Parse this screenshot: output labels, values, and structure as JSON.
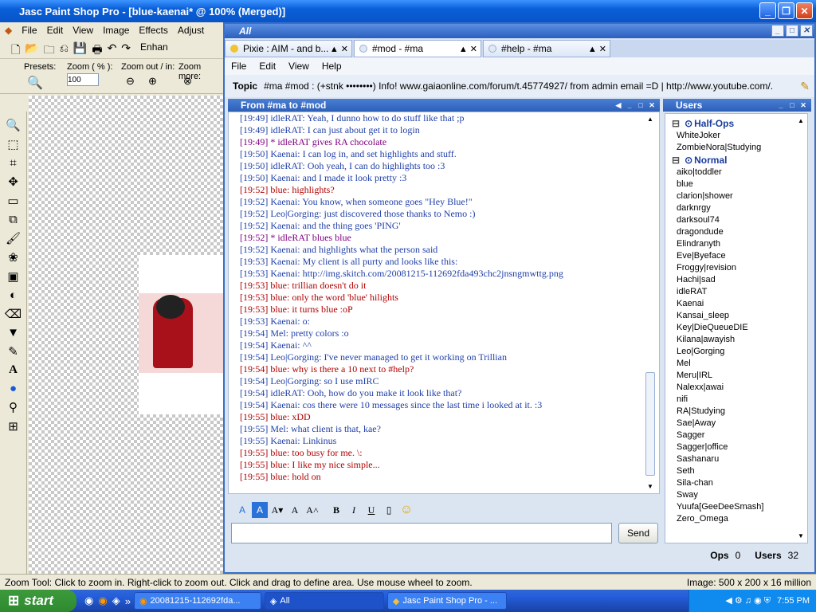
{
  "psp": {
    "title": "Jasc Paint Shop Pro - [blue-kaenai* @ 100% (Merged)]",
    "menu": [
      "File",
      "Edit",
      "View",
      "Image",
      "Effects",
      "Adjust"
    ],
    "opts": {
      "presets": "Presets:",
      "zoom_pct": "Zoom ( % ):",
      "zoom_value": "100",
      "zoom_outin": "Zoom out / in:",
      "zoom_more": "Zoom more:",
      "enhance": "Enhan"
    },
    "status_left": "Zoom Tool: Click to zoom in. Right-click to zoom out. Click and drag to define area. Use mouse wheel to zoom.",
    "status_right": "Image:  500 x 200 x 16 million"
  },
  "taskbar": {
    "start": "start",
    "tasks": [
      "20081215-112692fda...",
      "All",
      "Jasc Paint Shop Pro - ..."
    ],
    "clock": "7:55 PM"
  },
  "trillian": {
    "title": "All",
    "tabs": [
      {
        "label": "Pixie : AIM - and b...",
        "dot": "#f1c232"
      },
      {
        "label": "#mod - #ma",
        "dot": "#e0e8f4"
      },
      {
        "label": "#help - #ma",
        "dot": "#e0e8f4"
      }
    ],
    "menu": [
      "File",
      "Edit",
      "View",
      "Help"
    ],
    "topic_label": "Topic",
    "topic_text": "#ma #mod : (+stnk ••••••••) Info! www.gaiaonline.com/forum/t.45774927/ from admin email =D | http://www.youtube.com/...",
    "chat_title": "From #ma to #mod",
    "lines": [
      {
        "t": "[19:49] idleRAT: Yeah, I dunno how to do stuff like that ;p",
        "c": "#1f3fa8",
        "nick": "idleRAT"
      },
      {
        "t": "[19:49] idleRAT: I can just about get it to login",
        "c": "#1f3fa8"
      },
      {
        "t": "[19:49] * idleRAT gives RA chocolate",
        "c": "#800080"
      },
      {
        "t": "[19:50] Kaenai: I can log in, and set highlights and stuff.",
        "c": "#1f3fa8"
      },
      {
        "t": "[19:50] idleRAT: Ooh yeah, I can do highlights too :3",
        "c": "#1f3fa8"
      },
      {
        "t": "[19:50] Kaenai: and I made it look pretty :3",
        "c": "#1f3fa8"
      },
      {
        "t": "[19:52] blue: highlights?",
        "c": "#b00000"
      },
      {
        "t": "[19:52] Kaenai: You know, when someone goes \"Hey Blue!\"",
        "c": "#1f3fa8"
      },
      {
        "t": "[19:52] Leo|Gorging: just discovered those thanks to Nemo :)",
        "c": "#1f3fa8"
      },
      {
        "t": "[19:52] Kaenai: and the thing goes 'PING'",
        "c": "#1f3fa8"
      },
      {
        "t": "[19:52] * idleRAT blues blue",
        "c": "#800080"
      },
      {
        "t": "[19:52] Kaenai: and highlights what the person said",
        "c": "#1f3fa8"
      },
      {
        "t": "[19:53] Kaenai: My client is all purty and looks like this:",
        "c": "#1f3fa8"
      },
      {
        "t": "[19:53] Kaenai: http://img.skitch.com/20081215-112692fda493chc2jnsngmwttg.png",
        "c": "#1f3fa8"
      },
      {
        "t": "[19:53] blue: trillian doesn't do it",
        "c": "#b00000"
      },
      {
        "t": "[19:53] blue: only the word 'blue' hilights",
        "c": "#b00000"
      },
      {
        "t": "[19:53] blue: it turns blue :oP",
        "c": "#b00000"
      },
      {
        "t": "[19:53] Kaenai: o:",
        "c": "#1f3fa8"
      },
      {
        "t": "[19:54] Mel: pretty colors :o",
        "c": "#1f3fa8"
      },
      {
        "t": "[19:54] Kaenai: ^^",
        "c": "#1f3fa8"
      },
      {
        "t": "[19:54] Leo|Gorging: I've never managed to get it working on Trillian",
        "c": "#1f3fa8"
      },
      {
        "t": "[19:54] blue: why is there a 10 next to #help?",
        "c": "#b00000"
      },
      {
        "t": "[19:54] Leo|Gorging: so I use mIRC",
        "c": "#1f3fa8"
      },
      {
        "t": "[19:54] idleRAT: Ooh, how do you make it look like that?",
        "c": "#1f3fa8"
      },
      {
        "t": "[19:54] Kaenai: cos there were 10 messages since the last time i looked at it. :3",
        "c": "#1f3fa8"
      },
      {
        "t": "[19:55] blue: xDD",
        "c": "#b00000"
      },
      {
        "t": "[19:55] Mel: what client is that, kae?",
        "c": "#1f3fa8"
      },
      {
        "t": "[19:55] Kaenai: Linkinus",
        "c": "#1f3fa8"
      },
      {
        "t": "[19:55] blue: too busy for me. \\:",
        "c": "#b00000"
      },
      {
        "t": "[19:55] blue: I like my nice simple...",
        "c": "#b00000"
      },
      {
        "t": "[19:55] blue: hold on",
        "c": "#b00000"
      }
    ],
    "users_title": "Users",
    "groups": [
      {
        "name": "Half-Ops",
        "users": [
          "WhiteJoker",
          "ZombieNora|Studying"
        ]
      },
      {
        "name": "Normal",
        "users": [
          "aiko|toddler",
          "blue",
          "clarion|shower",
          "darknrgy",
          "darksoul74",
          "dragondude",
          "Elindranyth",
          "Eve|Byeface",
          "Froggy|revision",
          "Hachi|sad",
          "idleRAT",
          "Kaenai",
          "Kansai_sleep",
          "Key|DieQueueDIE",
          "Kilana|awayish",
          "Leo|Gorging",
          "Mel",
          "Meru|IRL",
          "Nalexx|awai",
          "nifi",
          "RA|Studying",
          "Sae|Away",
          "Sagger",
          "Sagger|office",
          "Sashanaru",
          "Seth",
          "Sila-chan",
          "Sway",
          "Yuufa[GeeDeeSmash]",
          "Zero_Omega"
        ]
      }
    ],
    "ops_label": "Ops",
    "ops_count": "0",
    "users_label": "Users",
    "users_count": "32",
    "send_label": "Send"
  }
}
